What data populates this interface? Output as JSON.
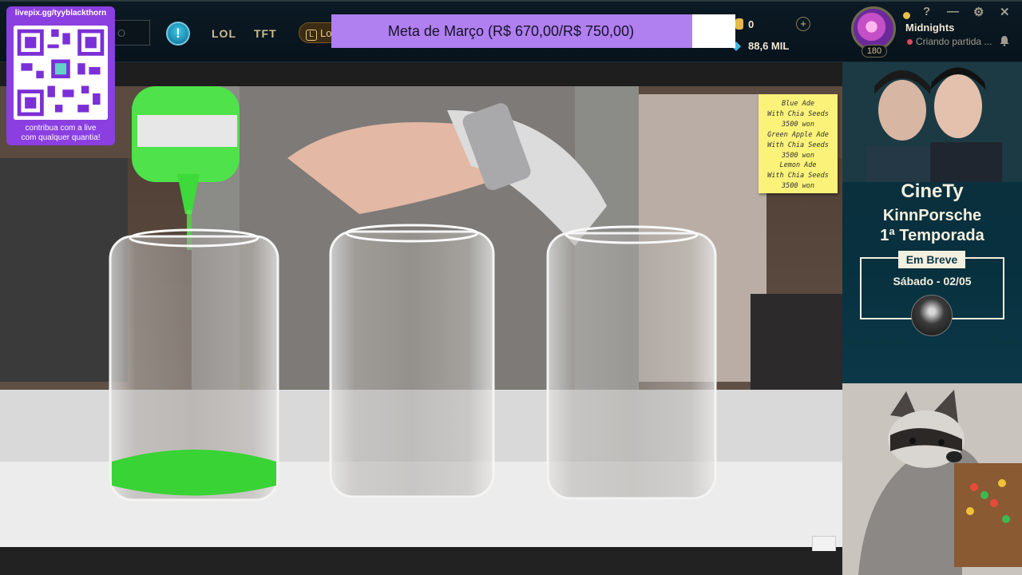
{
  "client": {
    "nav_tabs": [
      "LOL",
      "TFT"
    ],
    "lo_button": "Lo",
    "alert_icon": "!",
    "search_placeholder": "O",
    "rp_value": "0",
    "be_value": "88,6 MIL",
    "profile": {
      "username": "Midnights",
      "status": "Criando partida ...",
      "level": "180"
    },
    "window_controls": [
      "?",
      "—",
      "⚙",
      "✕"
    ]
  },
  "goal": {
    "text": "Meta de Março (R$ 670,00/R$ 750,00)",
    "current": 670,
    "target": 750,
    "fill_color": "#b07ff0"
  },
  "donation": {
    "url": "livepix.gg/tyyblackthorn",
    "caption_line1": "contribua com a live",
    "caption_line2": "com qualquer quantia!"
  },
  "stream_video": {
    "menu_note": "Blue Ade\nWith Chia Seeds\n3500 won\nGreen Apple Ade\nWith Chia Seeds\n3500 won\nLemon Ade\nWith Chia Seeds\n3500 won"
  },
  "promo": {
    "brand": "CineTy",
    "show": "KinnPorsche",
    "season": "1ª Temporada",
    "badge": "Em Breve",
    "date": "Sábado - 02/05"
  }
}
